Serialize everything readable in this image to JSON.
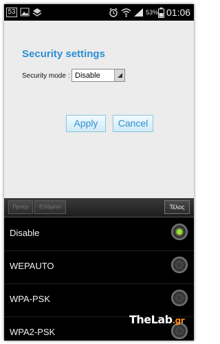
{
  "status_bar": {
    "notification_count": "53",
    "battery_percent": "53%",
    "time": "01:06",
    "icons": [
      "image-icon",
      "layers-icon",
      "alarm-icon",
      "wifi-icon",
      "signal-icon",
      "battery-icon"
    ]
  },
  "page": {
    "title": "Security settings",
    "security_mode_label": "Security mode :",
    "security_mode_value": "Disable",
    "apply_label": "Apply",
    "cancel_label": "Cancel"
  },
  "keyboard_toolbar": {
    "prev_label": "Προηγ",
    "next_label": "Επόμενο",
    "done_label": "Τέλος"
  },
  "options": [
    {
      "label": "Disable",
      "selected": true
    },
    {
      "label": "WEPAUTO",
      "selected": false
    },
    {
      "label": "WPA-PSK",
      "selected": false
    },
    {
      "label": "WPA2-PSK",
      "selected": false
    }
  ],
  "watermark": {
    "main": "TheLab",
    "suffix": ".gr"
  },
  "colors": {
    "accent": "#2a8ed3",
    "radio_selected": "#9be22a"
  }
}
